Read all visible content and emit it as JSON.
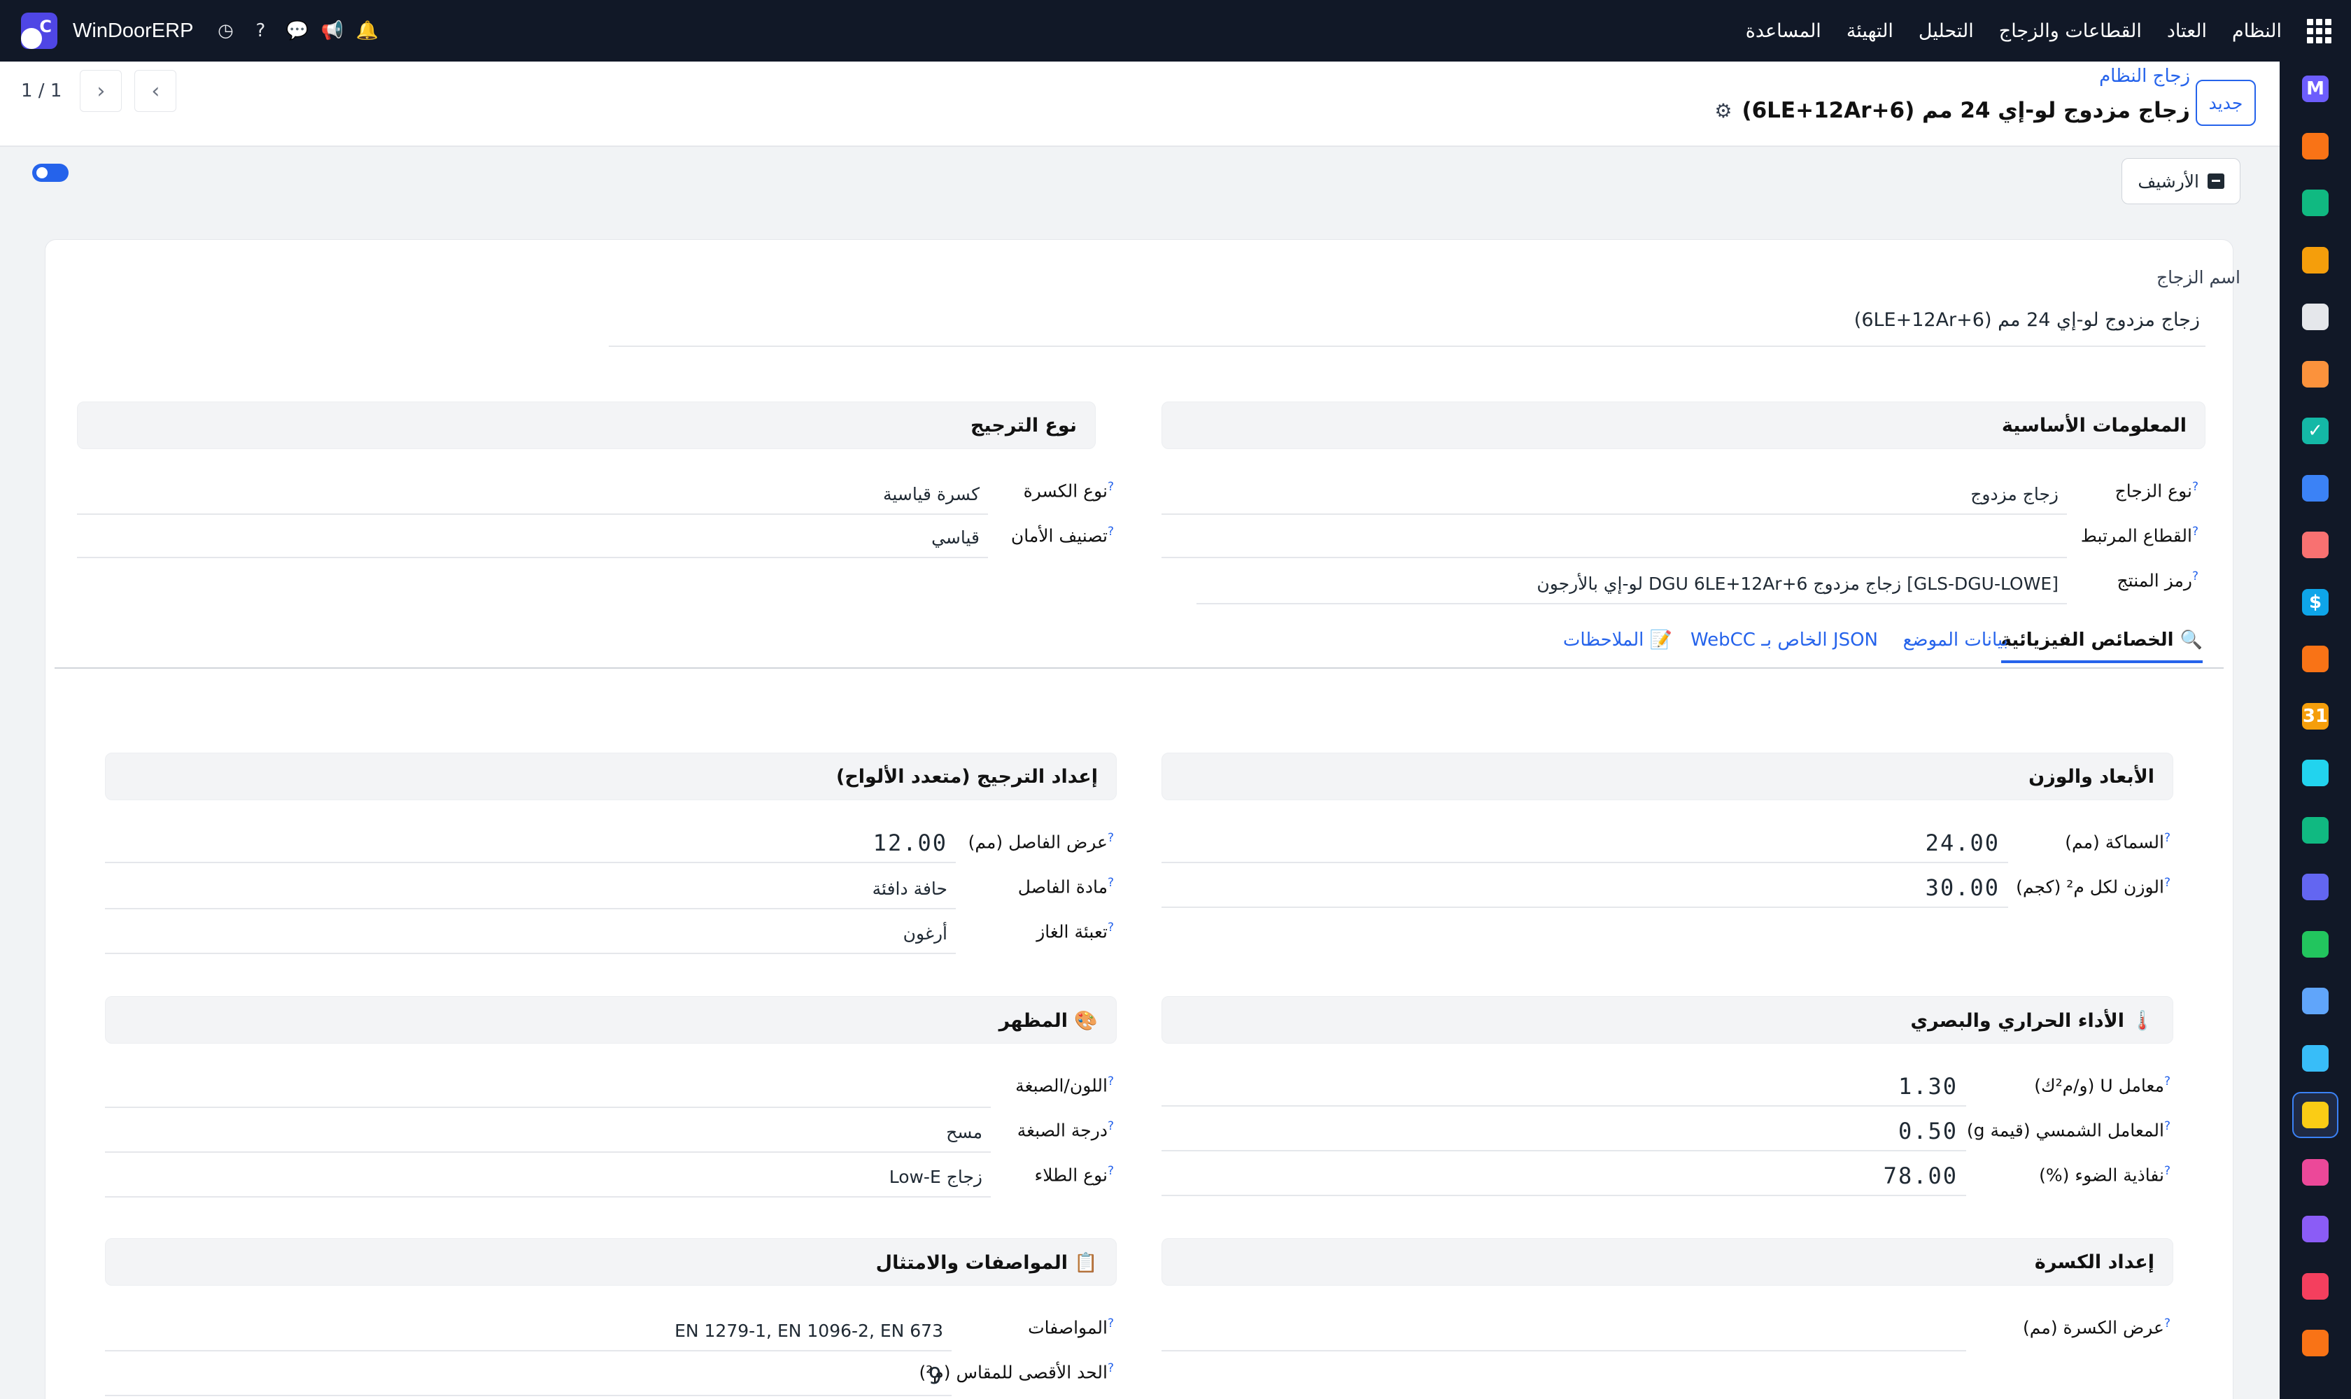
{
  "topbar": {
    "brand": "WinDoorERP",
    "brand_logo_letter": "C",
    "menu": [
      "النظام",
      "العتاد",
      "القطاعات والزجاج",
      "التحليل",
      "التهيئة",
      "المساعدة"
    ],
    "icons": [
      "clock-icon",
      "help-icon",
      "chat-icon",
      "megaphone-icon",
      "bell-icon"
    ]
  },
  "control_panel": {
    "breadcrumb": "زجاج النظام",
    "title": "زجاج مزدوج لو-إي 24 مم (6LE+12Ar+6)",
    "new_button": "جديد",
    "pager": "1 / 1",
    "archive_button": "الأرشيف"
  },
  "form": {
    "name_label": "اسم الزجاج",
    "name_value": "زجاج مزدوج لو-إي 24 مم (6LE+12Ar+6)",
    "basic_info": {
      "title": "المعلومات الأساسية",
      "glass_type_label": "نوع الزجاج",
      "glass_type_value": "زجاج مزدوج",
      "related_profile_label": "القطاع المرتبط",
      "related_profile_value": "",
      "product_code_label": "رمز المنتج",
      "product_code_value": "[GLS-DGU-LOWE] زجاج مزدوج DGU 6LE+12Ar+6 لو-إي بالأرجون"
    },
    "glazing_type": {
      "title": "نوع الترجيج",
      "bead_type_label": "نوع الكسرة",
      "bead_type_value": "كسرة قياسية",
      "safety_label": "تصنيف الأمان",
      "safety_value": "قياسي"
    },
    "tabs": [
      "🔍 الخصائص الفيزيائية",
      "بيانات الموضع",
      "JSON الخاص بـ WebCC",
      "📝 الملاحظات"
    ],
    "dimensions": {
      "title": "الأبعاد والوزن",
      "thickness_label": "السماكة (مم)",
      "thickness_value": "24.00",
      "weight_label": "الوزن لكل م² (كجم)",
      "weight_value": "30.00"
    },
    "glazing_setup": {
      "title": "إعداد الترجيج (متعدد الألواح)",
      "spacer_width_label": "عرض الفاصل (مم)",
      "spacer_width_value": "12.00",
      "spacer_material_label": "مادة الفاصل",
      "spacer_material_value": "حافة دافئة",
      "gas_fill_label": "تعبئة الغاز",
      "gas_fill_value": "أرغون"
    },
    "thermal": {
      "title": "🌡️ الأداء الحراري والبصري",
      "u_value_label": "معامل U (و/م²ك)",
      "u_value": "1.30",
      "g_value_label": "المعامل الشمسي (قيمة g)",
      "g_value": "0.50",
      "light_label": "نفاذية الضوء (%)",
      "light_value": "78.00"
    },
    "appearance": {
      "title": "🎨 المظهر",
      "color_label": "اللون/الصبغة",
      "color_value": "",
      "tint_label": "درجة الصبغة",
      "tint_value": "مسح",
      "coating_label": "نوع الطلاء",
      "coating_value": "زجاج Low-E"
    },
    "bead_setup": {
      "title": "إعداد الكسرة",
      "bead_width_label": "عرض الكسرة (مم)",
      "bead_width_value": ""
    },
    "specs": {
      "title": "📋 المواصفات والامتثال",
      "specs_label": "المواصفات",
      "specs_value": "EN 1279-1, EN 1096-2, EN 673",
      "max_size_label": "الحد الأقصى للمقاس (م²)",
      "max_size_value": "9"
    }
  },
  "dock_apps": [
    {
      "name": "m-app-icon",
      "color": "#6d5dfc",
      "glyph": "M"
    },
    {
      "name": "chat-bubble-app-icon",
      "color": "#f97316",
      "glyph": ""
    },
    {
      "name": "ribbon-app-icon",
      "color": "#10b981",
      "glyph": ""
    },
    {
      "name": "bar-chart-app-icon",
      "color": "#f59e0b",
      "glyph": ""
    },
    {
      "name": "cube-app-icon",
      "color": "#e5e7eb",
      "glyph": ""
    },
    {
      "name": "image-app-icon",
      "color": "#fb923c",
      "glyph": ""
    },
    {
      "name": "checkmark-app-icon",
      "color": "#14b8a6",
      "glyph": "✓"
    },
    {
      "name": "book-app-icon",
      "color": "#3b82f6",
      "glyph": ""
    },
    {
      "name": "package-app-icon",
      "color": "#f87171",
      "glyph": ""
    },
    {
      "name": "dollar-app-icon",
      "color": "#0ea5e9",
      "glyph": "$"
    },
    {
      "name": "people-app-icon",
      "color": "#f97316",
      "glyph": ""
    },
    {
      "name": "calendar-app-icon",
      "color": "#f59e0b",
      "glyph": "31"
    },
    {
      "name": "pen-app-icon",
      "color": "#22d3ee",
      "glyph": ""
    },
    {
      "name": "contact-card-app-icon",
      "color": "#10b981",
      "glyph": ""
    },
    {
      "name": "dashboard-app-icon",
      "color": "#6366f1",
      "glyph": ""
    },
    {
      "name": "whatsapp-app-icon",
      "color": "#22c55e",
      "glyph": ""
    },
    {
      "name": "compass-app-icon",
      "color": "#60a5fa",
      "glyph": ""
    },
    {
      "name": "wave-app-icon",
      "color": "#38bdf8",
      "glyph": ""
    },
    {
      "name": "paper-plane-app-icon",
      "color": "#facc15",
      "glyph": ""
    },
    {
      "name": "stripes-app-icon",
      "color": "#ec4899",
      "glyph": ""
    },
    {
      "name": "hexagon-app-icon",
      "color": "#8b5cf6",
      "glyph": ""
    },
    {
      "name": "pie-app-icon",
      "color": "#f43f5e",
      "glyph": ""
    },
    {
      "name": "gear-hexagon-app-icon",
      "color": "#f97316",
      "glyph": ""
    }
  ]
}
